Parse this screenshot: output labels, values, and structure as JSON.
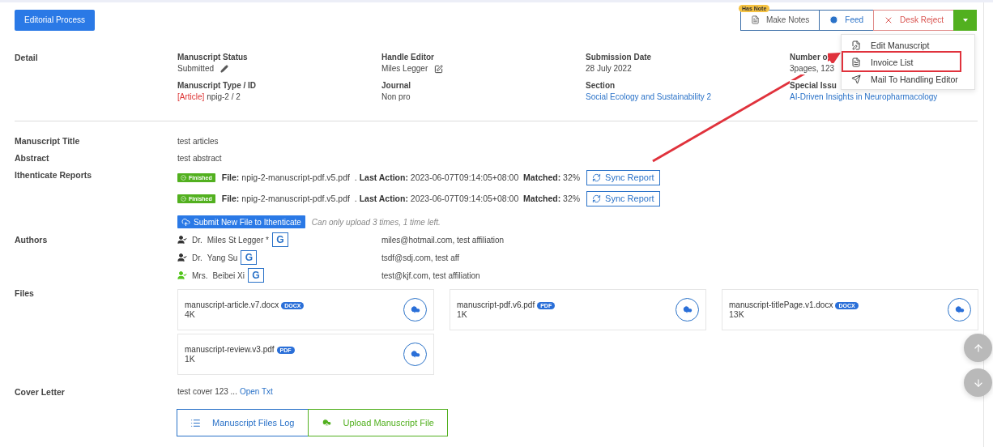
{
  "header": {
    "primary_button": "Editorial Process",
    "note_badge": "Has Note",
    "actions": [
      {
        "kind": "notes",
        "label": "Make Notes"
      },
      {
        "kind": "feed",
        "label": "Feed"
      },
      {
        "kind": "reject",
        "label": "Desk Reject"
      }
    ],
    "menu": {
      "expanded": true,
      "items": [
        {
          "kind": "edit",
          "label": "Edit Manuscript",
          "highlighted": false
        },
        {
          "kind": "invoice",
          "label": "Invoice List",
          "highlighted": true
        },
        {
          "kind": "mail",
          "label": "Mail To Handling Editor",
          "highlighted": false
        }
      ]
    }
  },
  "detail": {
    "label": "Detail",
    "fields": [
      {
        "label": "Manuscript Status",
        "value": "Submitted",
        "kind": "pencil"
      },
      {
        "label": "Handle Editor",
        "value": "Miles Legger",
        "kind": "edit"
      },
      {
        "label": "Submission Date",
        "value": "28 July 2022",
        "kind": "plain"
      },
      {
        "label": "Number o",
        "value": "3pages, 123",
        "kind": "plain"
      },
      {
        "label": "Manuscript Type / ID",
        "tag": "[Article]",
        "value": "npig-2 / 2",
        "kind": "typed"
      },
      {
        "label": "Journal",
        "value": "Non pro",
        "kind": "plain"
      },
      {
        "label": "Section",
        "value": "Social Ecology and Sustainability 2",
        "kind": "link"
      },
      {
        "label": "Special Issu",
        "value": "AI-Driven Insights in Neuropharmacology",
        "kind": "link"
      }
    ]
  },
  "title": {
    "label": "Manuscript Title",
    "value": "test articles"
  },
  "abstract": {
    "label": "Abstract",
    "value": "test abstract"
  },
  "ithenticate": {
    "label": "Ithenticate Reports",
    "reports": [
      {
        "status": "Finished",
        "text": "**File:** npig-2-manuscript-pdf.v5.pdf  . **Last Action:** 2023-06-07T09:14:05+08:00  **Matched:** 32%",
        "sync": "Sync Report"
      },
      {
        "status": "Finished",
        "text": "**File:** npig-2-manuscript-pdf.v5.pdf  . **Last Action:** 2023-06-07T09:14:05+08:00  **Matched:** 32%",
        "sync": "Sync Report"
      }
    ],
    "submit_button": "Submit New File to Ithenticate",
    "note": "Can only upload 3 times, 1 time left."
  },
  "authors": {
    "label": "Authors",
    "items": [
      {
        "title": "Dr.",
        "name": "Miles St Legger *",
        "scholar": "G",
        "contact": "miles@hotmail.com, test affiliation",
        "color": "#333333"
      },
      {
        "title": "Dr.",
        "name": "Yang Su",
        "scholar": "G",
        "contact": "tsdf@sdj.com, test aff",
        "color": "#333333"
      },
      {
        "title": "Mrs.",
        "name": "Beibei Xi",
        "scholar": "G",
        "contact": "test@kjf.com, test affiliation",
        "color": "#52c41a"
      }
    ]
  },
  "files": {
    "label": "Files",
    "items": [
      {
        "name": "manuscript-article.v7.docx",
        "type": "DOCX",
        "size": "4K"
      },
      {
        "name": "manuscript-pdf.v6.pdf",
        "type": "PDF",
        "size": "1K"
      },
      {
        "name": "manuscript-titlePage.v1.docx",
        "type": "DOCX",
        "size": "13K"
      },
      {
        "name": "manuscript-review.v3.pdf",
        "type": "PDF",
        "size": "1K"
      }
    ]
  },
  "cover_letter": {
    "label": "Cover Letter",
    "text": "test cover 123 ...",
    "link": "Open Txt"
  },
  "bottom_buttons": [
    {
      "kind": "log",
      "label": "Manuscript Files Log"
    },
    {
      "kind": "upload",
      "label": "Upload Manuscript File"
    }
  ]
}
